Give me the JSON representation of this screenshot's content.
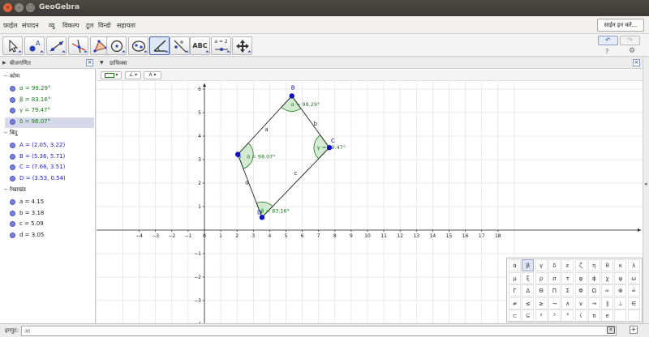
{
  "window": {
    "title": "GeoGebra"
  },
  "menu": {
    "items": [
      "फ़ाईल",
      "संपादन",
      "व्यू",
      "विकल्प",
      "टूल",
      "विन्डो",
      "सहायता"
    ],
    "sign_in": "साईन इन करें..."
  },
  "toolbar": {
    "tools": [
      "move-tool",
      "point-tool",
      "line-tool",
      "perpendicular-line-tool",
      "polygon-tool",
      "circle-tool",
      "conic-tool",
      "angle-tool",
      "reflect-tool",
      "text-tool",
      "slider-tool",
      "move-graphics-view-tool"
    ],
    "text_tool_label": "ABC",
    "slider_tool_label": "a = 2",
    "selected_tool": "angle-tool",
    "undo_label": "↶",
    "redo_label": "↷",
    "help_label": "?",
    "settings_label": "⚙"
  },
  "algebra": {
    "title": "बीजगणित",
    "groups": [
      {
        "name": "कोण",
        "items": [
          {
            "text": "α = 99.29°",
            "color": "#1a7a1a",
            "highlight": false
          },
          {
            "text": "β = 83.16°",
            "color": "#1a7a1a",
            "highlight": false
          },
          {
            "text": "γ = 79.47°",
            "color": "#1a7a1a",
            "highlight": false
          },
          {
            "text": "δ = 98.07°",
            "color": "#1a7a1a",
            "highlight": true
          }
        ]
      },
      {
        "name": "बिंदु",
        "items": [
          {
            "text": "A = (2.05, 3.22)",
            "color": "#1a1acc",
            "highlight": false
          },
          {
            "text": "B = (5.36, 5.71)",
            "color": "#1a1acc",
            "highlight": false
          },
          {
            "text": "C = (7.66, 3.51)",
            "color": "#1a1acc",
            "highlight": false
          },
          {
            "text": "D = (3.53, 0.54)",
            "color": "#1a1acc",
            "highlight": false
          }
        ]
      },
      {
        "name": "रेखाखंड",
        "items": [
          {
            "text": "a = 4.15",
            "color": "#222222",
            "highlight": false
          },
          {
            "text": "b = 3.18",
            "color": "#222222",
            "highlight": false
          },
          {
            "text": "c = 5.09",
            "color": "#222222",
            "highlight": false
          },
          {
            "text": "d = 3.05",
            "color": "#222222",
            "highlight": false
          }
        ]
      }
    ]
  },
  "graphics": {
    "title": "ग्राफिक्स",
    "style_labels": [
      "",
      "∠",
      "A"
    ],
    "x_ticks": [
      -4,
      -3,
      -2,
      -1,
      0,
      1,
      2,
      3,
      4,
      5,
      6,
      7,
      8,
      9,
      10,
      11,
      12,
      13,
      14,
      15,
      16,
      17,
      18
    ],
    "y_ticks": [
      -4,
      -3,
      -2,
      -1,
      0,
      1,
      2,
      3,
      4,
      5,
      6
    ],
    "points": [
      {
        "name": "A",
        "x": 2.05,
        "y": 3.22
      },
      {
        "name": "B",
        "x": 5.36,
        "y": 5.71
      },
      {
        "name": "C",
        "x": 7.66,
        "y": 3.51
      },
      {
        "name": "D",
        "x": 3.53,
        "y": 0.54
      }
    ],
    "segments": [
      {
        "name": "a",
        "from": "A",
        "to": "B"
      },
      {
        "name": "b",
        "from": "B",
        "to": "C"
      },
      {
        "name": "c",
        "from": "C",
        "to": "D"
      },
      {
        "name": "d",
        "from": "D",
        "to": "A"
      }
    ],
    "angles": [
      {
        "vertex": "B",
        "label": "α = 99.29°"
      },
      {
        "vertex": "D",
        "label": "β = 83.16°"
      },
      {
        "vertex": "C",
        "label": "γ = 79.47°"
      },
      {
        "vertex": "A",
        "label": "δ = 98.07°"
      }
    ],
    "colors": {
      "point": "#1010c0",
      "angle_fill": "#c8e6c8",
      "angle_stroke": "#1a7a1a",
      "angle_text": "#1a7a1a",
      "grid": "#e2e2e2",
      "axis": "#222222"
    }
  },
  "greek_keyboard": {
    "rows": [
      [
        "α",
        "β",
        "γ",
        "δ",
        "ε",
        "ζ",
        "η",
        "θ",
        "κ",
        "λ"
      ],
      [
        "μ",
        "ξ",
        "ρ",
        "σ",
        "τ",
        "φ",
        "ϕ",
        "χ",
        "ψ",
        "ω"
      ],
      [
        "Γ",
        "Δ",
        "Θ",
        "Π",
        "Σ",
        "Φ",
        "Ω",
        "∞",
        "⊗",
        "≟"
      ],
      [
        "≠",
        "≤",
        "≥",
        "¬",
        "∧",
        "∨",
        "→",
        "∥",
        "⊥",
        "∈"
      ],
      [
        "⊂",
        "⊆",
        "²",
        "³",
        "°",
        "ί",
        "π",
        "e",
        "",
        ""
      ]
    ],
    "selected": "β"
  },
  "input": {
    "label": "इनपुट:",
    "placeholder": "आ"
  }
}
